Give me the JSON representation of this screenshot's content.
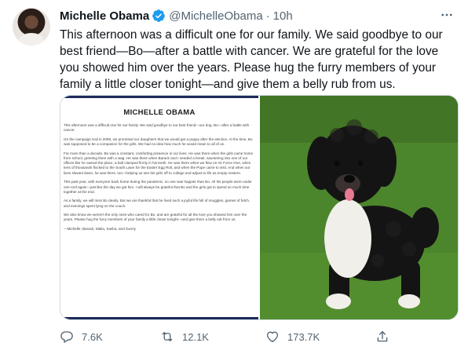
{
  "author": {
    "name": "Michelle Obama",
    "handle": "@MichelleObama",
    "separator": "·",
    "time": "10h"
  },
  "tweet_text": "This afternoon was a difficult one for our family. We said goodbye to our best friend—Bo—after a battle with cancer. We are grateful for the love you showed him over the years. Please hug the furry members of your family a little closer tonight—and give them a belly rub from us.",
  "document": {
    "title": "MICHELLE OBAMA",
    "paragraphs": [
      "This afternoon was a difficult one for our family. We said goodbye to our best friend—our dog, Bo—after a battle with cancer.",
      "On the campaign trail in 2008, we promised our daughters that we would get a puppy after the election. At the time, Bo was supposed to be a companion for the girls. We had no idea how much he would mean to all of us.",
      "For more than a decade, Bo was a constant, comforting presence in our lives. He was there when the girls came home from school, greeting them with a wag. He was there when Barack and I needed a break, sauntering into one of our offices like he owned the place, a ball clamped firmly in his teeth. He was there when we flew on Air Force One, when tens of thousands flocked to the South Lawn for the Easter Egg Roll, and when the Pope came to visit. And when our lives slowed down, he was there, too—helping us see the girls off to college and adjust to life as empty nesters.",
      "This past year, with everyone back home during the pandemic, no one was happier than Bo. All his people were under one roof again—just like the day we got him. I will always be grateful that Bo and the girls got to spend so much time together at the end.",
      "As a family, we will miss Bo dearly. But we are thankful that he lived such a joyful life full of snuggles, games of fetch, and evenings spent lying on the couch.",
      "We also know we weren't the only ones who cared for Bo, and are grateful for all the love you showed him over the years. Please hug the furry members of your family a little closer tonight—and give them a belly rub from us.",
      "—Michelle, Barack, Malia, Sasha, and Sunny"
    ]
  },
  "metrics": {
    "replies": "7.6K",
    "retweets": "12.1K",
    "likes": "173.7K"
  },
  "icons": {
    "verified": "verified-badge-icon",
    "more": "more-icon",
    "reply": "reply-icon",
    "retweet": "retweet-icon",
    "like": "heart-icon",
    "share": "share-icon"
  },
  "colors": {
    "verified": "#1d9bf0",
    "muted": "#536471",
    "text": "#0f1419",
    "doc_accent": "#1d2a5b"
  }
}
